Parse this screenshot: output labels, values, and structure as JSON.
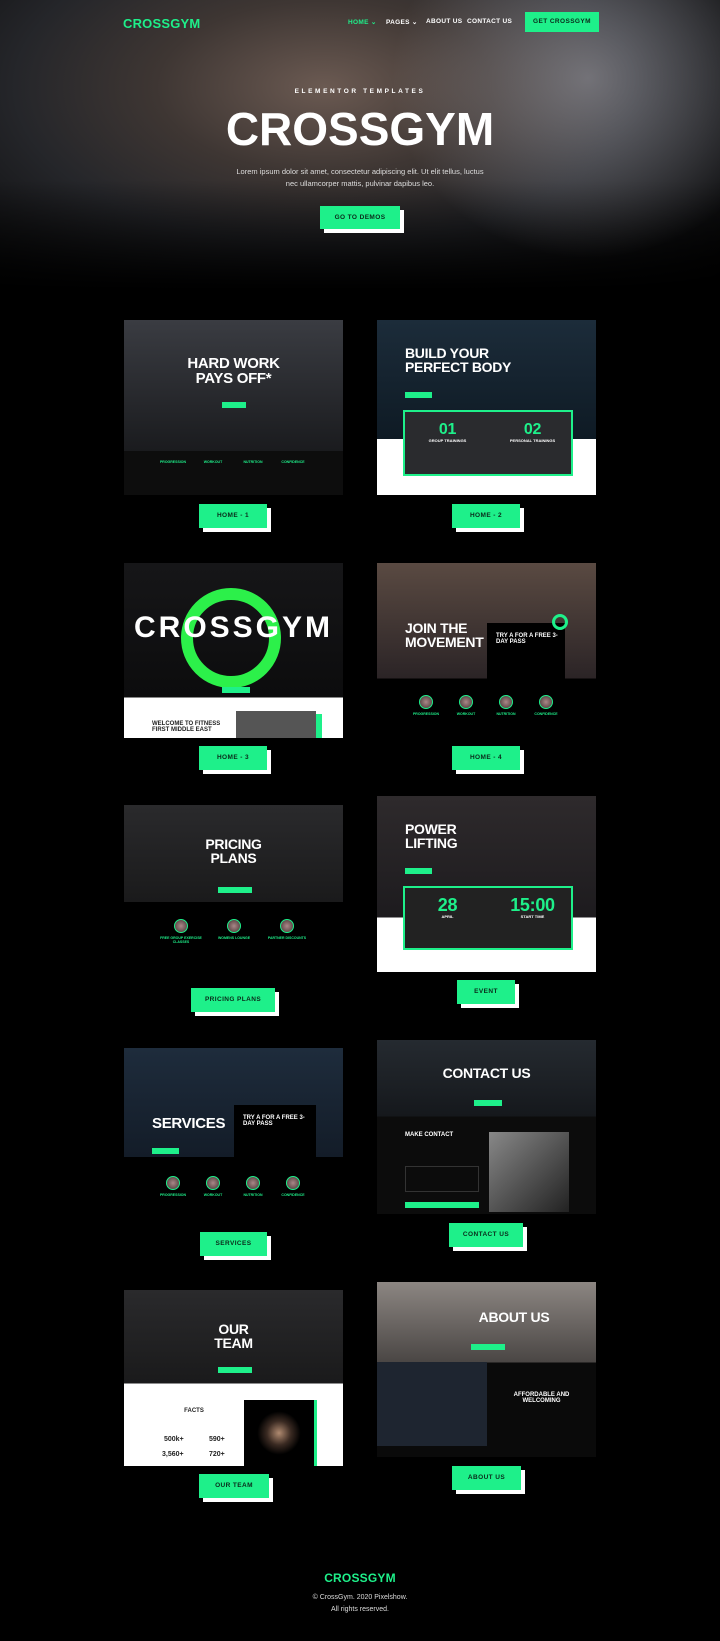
{
  "brand": {
    "logo": "CROSSGYM",
    "accent": "#1ef08a"
  },
  "nav": {
    "items": [
      {
        "label": "HOME",
        "active": true,
        "has_dropdown": true
      },
      {
        "label": "PAGES",
        "has_dropdown": true
      },
      {
        "label": "ABOUT US"
      },
      {
        "label": "CONTACT US"
      }
    ],
    "cta": "GET CROSSGYM",
    "chevron": "chevron-down-icon"
  },
  "hero": {
    "eyebrow": "ELEMENTOR TEMPLATES",
    "title": "CROSSGYM",
    "text_line1": "Lorem ipsum dolor sit amet, consectetur adipiscing elit. Ut elit tellus, luctus",
    "text_line2": "nec ullamcorper mattis, pulvinar dapibus leo.",
    "button": "GO TO DEMOS"
  },
  "demos": [
    {
      "label": "HOME - 1",
      "headline1": "HARD WORK",
      "headline2": "PAYS OFF*",
      "features": [
        "PROGRESSION",
        "WORKOUT",
        "NUTRITION",
        "CONFIDENCE"
      ]
    },
    {
      "label": "HOME - 2",
      "headline1": "BUILD YOUR",
      "headline2": "PERFECT BODY",
      "box1_num": "01",
      "box1_label": "GROUP TRAININGS",
      "box2_num": "02",
      "box2_label": "PERSONAL TRAININGS"
    },
    {
      "label": "HOME - 3",
      "headline": "CROSSGYM",
      "welcome1": "WELCOME TO FITNESS",
      "welcome2": "FIRST MIDDLE EAST"
    },
    {
      "label": "HOME - 4",
      "headline1": "JOIN THE",
      "headline2": "MOVEMENT",
      "pass1": "TRY A FOR A FREE 3-",
      "pass2": "DAY PASS",
      "features": [
        "PROGRESSION",
        "WORKOUT",
        "NUTRITION",
        "CONFIDENCE"
      ]
    },
    {
      "label": "PRICING PLANS",
      "headline1": "PRICING",
      "headline2": "PLANS",
      "features": [
        "FREE GROUP EXERCISE CLASSES",
        "WOMENS LOUNGE",
        "PARTNER DISCOUNTS"
      ]
    },
    {
      "label": "EVENT",
      "headline1": "POWER",
      "headline2": "LIFTING",
      "box1_num": "28",
      "box1_label": "APRIL",
      "box2_num": "15:00",
      "box2_label": "START TIME"
    },
    {
      "label": "SERVICES",
      "headline": "SERVICES",
      "pass1": "TRY A FOR A FREE 3-",
      "pass2": "DAY PASS",
      "features": [
        "PROGRESSION",
        "WORKOUT",
        "NUTRITION",
        "CONFIDENCE"
      ]
    },
    {
      "label": "CONTACT US",
      "headline": "CONTACT US",
      "form_title": "MAKE CONTACT"
    },
    {
      "label": "OUR TEAM",
      "headline1": "OUR",
      "headline2": "TEAM",
      "facts_title": "FACTS",
      "facts": [
        "500k+",
        "590+",
        "3,560+",
        "720+"
      ]
    },
    {
      "label": "ABOUT US",
      "headline": "ABOUT US",
      "sub1": "AFFORDABLE AND",
      "sub2": "WELCOMING"
    }
  ],
  "footer": {
    "logo": "CROSSGYM",
    "copyright": "© CrossGym. 2020 Pixelshow.",
    "rights": "All rights reserved."
  }
}
